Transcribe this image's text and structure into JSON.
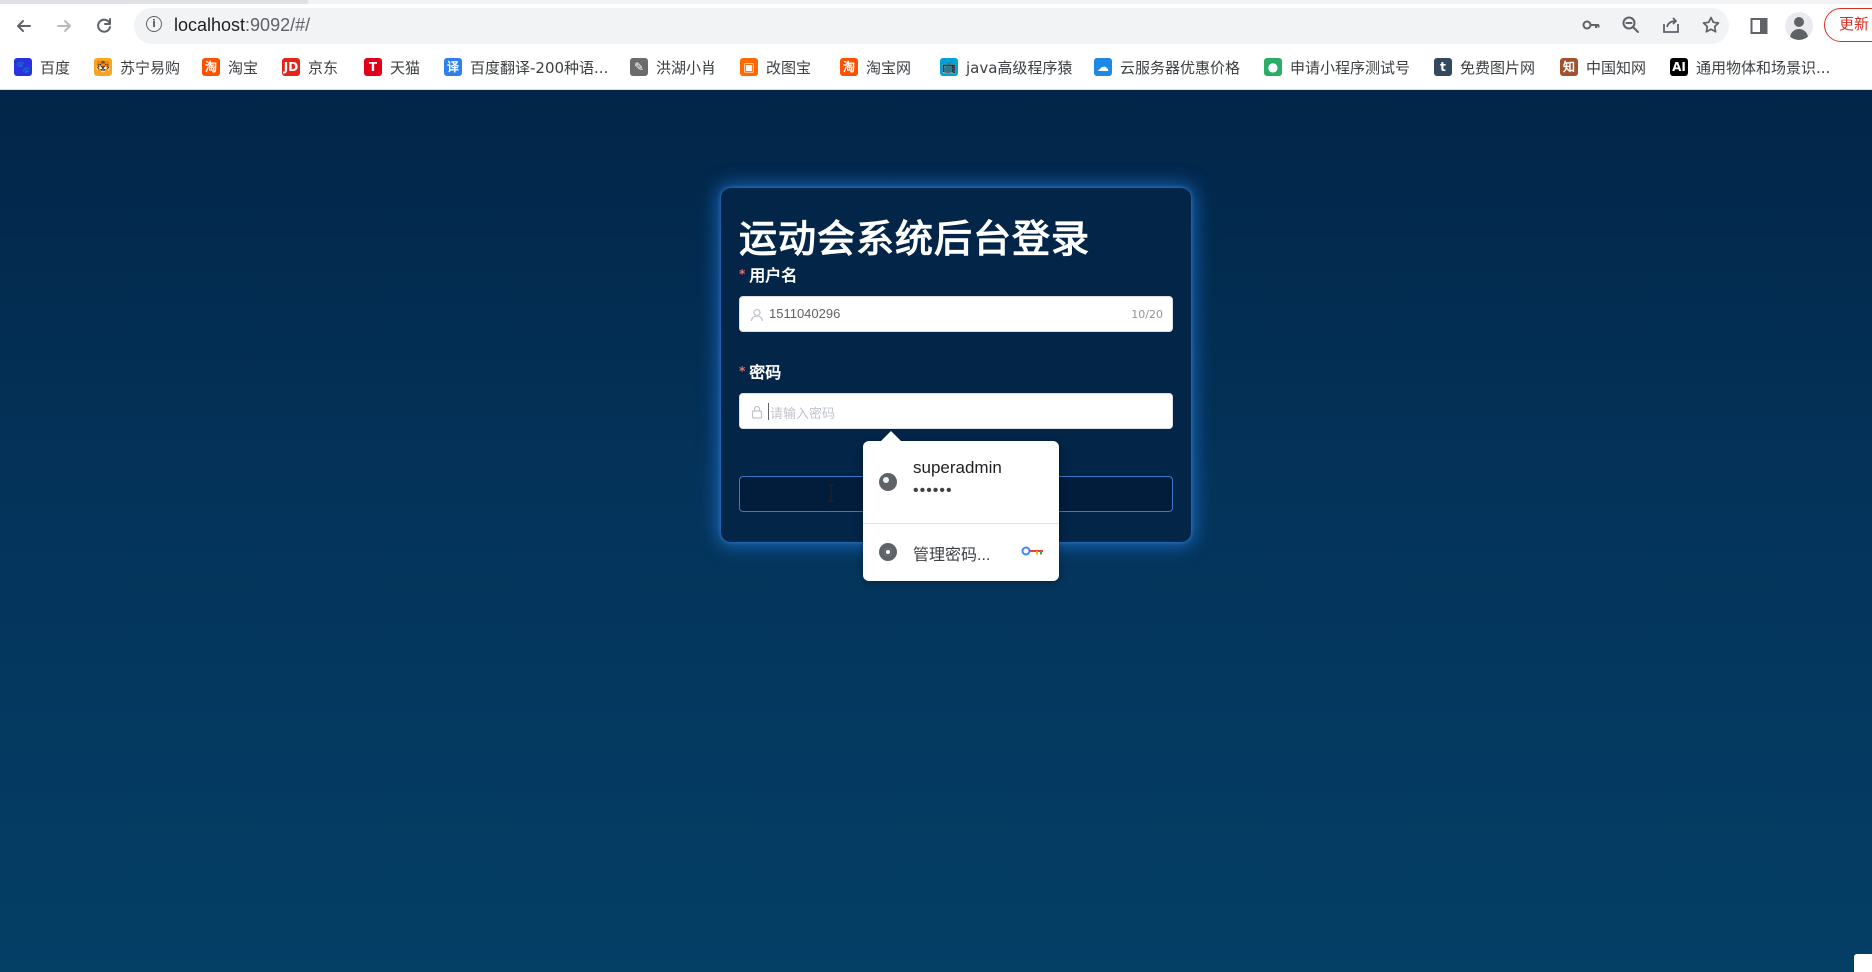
{
  "browser": {
    "url_host": "localhost",
    "url_rest": ":9092/#/",
    "update_label": "更新",
    "icons": {
      "back": "arrow-left-icon",
      "forward": "arrow-right-icon",
      "reload": "reload-icon",
      "info": "info-icon",
      "key": "key-icon",
      "zoom": "zoom-out-icon",
      "share": "share-icon",
      "star": "star-icon",
      "sidepanel": "side-panel-icon",
      "profile": "profile-icon"
    }
  },
  "bookmarks": [
    {
      "label": "百度",
      "color": "#2932e1"
    },
    {
      "label": "苏宁易购",
      "color": "#f5a623"
    },
    {
      "label": "淘宝",
      "color": "#ff5000"
    },
    {
      "label": "京东",
      "color": "#e1251b"
    },
    {
      "label": "天猫",
      "color": "#e1001a"
    },
    {
      "label": "百度翻译-200种语...",
      "color": "#2f80ed"
    },
    {
      "label": "洪湖小肖",
      "color": "#6b6b6b"
    },
    {
      "label": "改图宝",
      "color": "#ff6a00"
    },
    {
      "label": "淘宝网",
      "color": "#ff5000"
    },
    {
      "label": "java高级程序猿",
      "color": "#00a1d6"
    },
    {
      "label": "云服务器优惠价格",
      "color": "#1e88e5"
    },
    {
      "label": "申请小程序测试号",
      "color": "#2aae67"
    },
    {
      "label": "免费图片网",
      "color": "#34495e"
    },
    {
      "label": "中国知网",
      "color": "#a0522d"
    },
    {
      "label": "通用物体和场景识...",
      "color": "#000000"
    }
  ],
  "bookmark_glyphs": [
    "🐾",
    "🐯",
    "淘",
    "JD",
    "T",
    "译",
    "✎",
    "▣",
    "淘",
    "📺",
    "☁",
    "●",
    "t",
    "知",
    "AI"
  ],
  "login": {
    "title": "运动会系统后台登录",
    "username_label": "用户名",
    "username_value": "1511040296",
    "username_count": "10/20",
    "password_label": "密码",
    "password_placeholder": "请输入密码",
    "required_mark": "*"
  },
  "autofill": {
    "username": "superadmin",
    "password_mask": "••••••",
    "manage_label": "管理密码..."
  },
  "colors": {
    "page_bg": "#022548",
    "card_glow": "#288cff",
    "required": "#f56c6c",
    "update_red": "#d93025"
  }
}
